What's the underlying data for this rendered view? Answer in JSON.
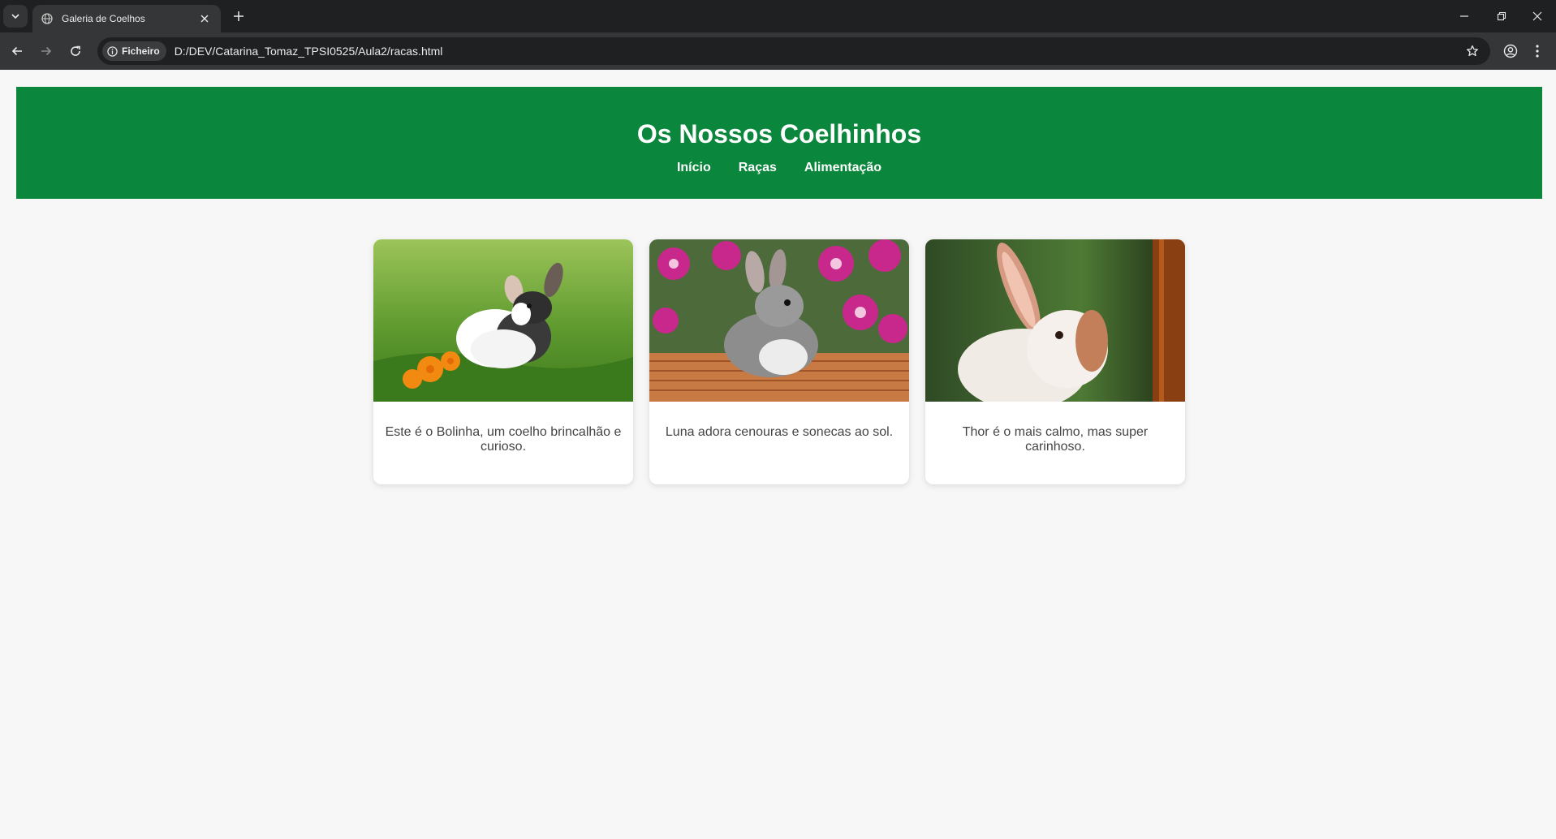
{
  "browser": {
    "tab_title": "Galeria de Coelhos",
    "address_chip": "Ficheiro",
    "url": "D:/DEV/Catarina_Tomaz_TPSI0525/Aula2/racas.html",
    "icons": [
      "tab-list-icon",
      "globe-icon",
      "close-icon",
      "plus-icon",
      "minimize-icon",
      "restore-icon",
      "close-window-icon",
      "back-icon",
      "forward-icon",
      "reload-icon",
      "info-icon",
      "star-icon",
      "profile-icon",
      "menu-dots-icon"
    ]
  },
  "header": {
    "title": "Os Nossos Coelhinhos",
    "nav": [
      "Início",
      "Raças",
      "Alimentação"
    ],
    "background_color": "#0a873c"
  },
  "gallery": {
    "cards": [
      {
        "caption": "Este é o Bolinha, um coelho brincalhão e curioso.",
        "photo": "rabbit-photo-bolinha"
      },
      {
        "caption": "Luna adora cenouras e sonecas ao sol.",
        "photo": "rabbit-photo-luna"
      },
      {
        "caption": "Thor é o mais calmo, mas super carinhoso.",
        "photo": "rabbit-photo-thor"
      }
    ]
  }
}
